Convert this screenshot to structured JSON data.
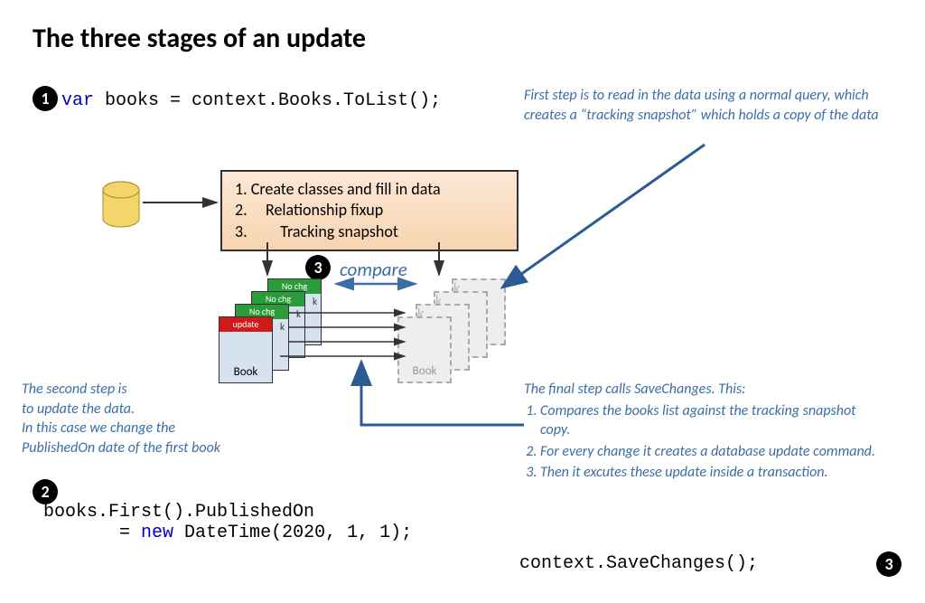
{
  "title": "The three stages of an update",
  "bullets": {
    "one": "1",
    "two": "2",
    "three": "3"
  },
  "code1": {
    "kw": "var",
    "rest": " books = context.Books.ToList();"
  },
  "code2": {
    "line1": "books.First().PublishedOn",
    "pre": "       = ",
    "kw": "new",
    "rest": " DateTime(2020, 1, 1);"
  },
  "code3": "context.SaveChanges();",
  "note1": "First step is to read in the data using a normal query, which creates a “tracking snapshot” which holds a copy of the data",
  "note2": "The second step is\nto update the data.\nIn this case we change the\nPublishedOn date of the first book",
  "note3": {
    "intro": "The final step calls SaveChanges. This:",
    "items": [
      "Compares the books list against the tracking snapshot copy.",
      "For every change it creates a database update command.",
      "Then it excutes these update inside a transaction."
    ]
  },
  "process": {
    "l1": "1. Create classes and fill in data",
    "l2": "2.     Relationship fixup",
    "l3": "3.         Tracking snapshot"
  },
  "compare_label": "compare",
  "cards": {
    "update": "update",
    "nochg": "No chg",
    "book": "Book",
    "k": "k"
  }
}
